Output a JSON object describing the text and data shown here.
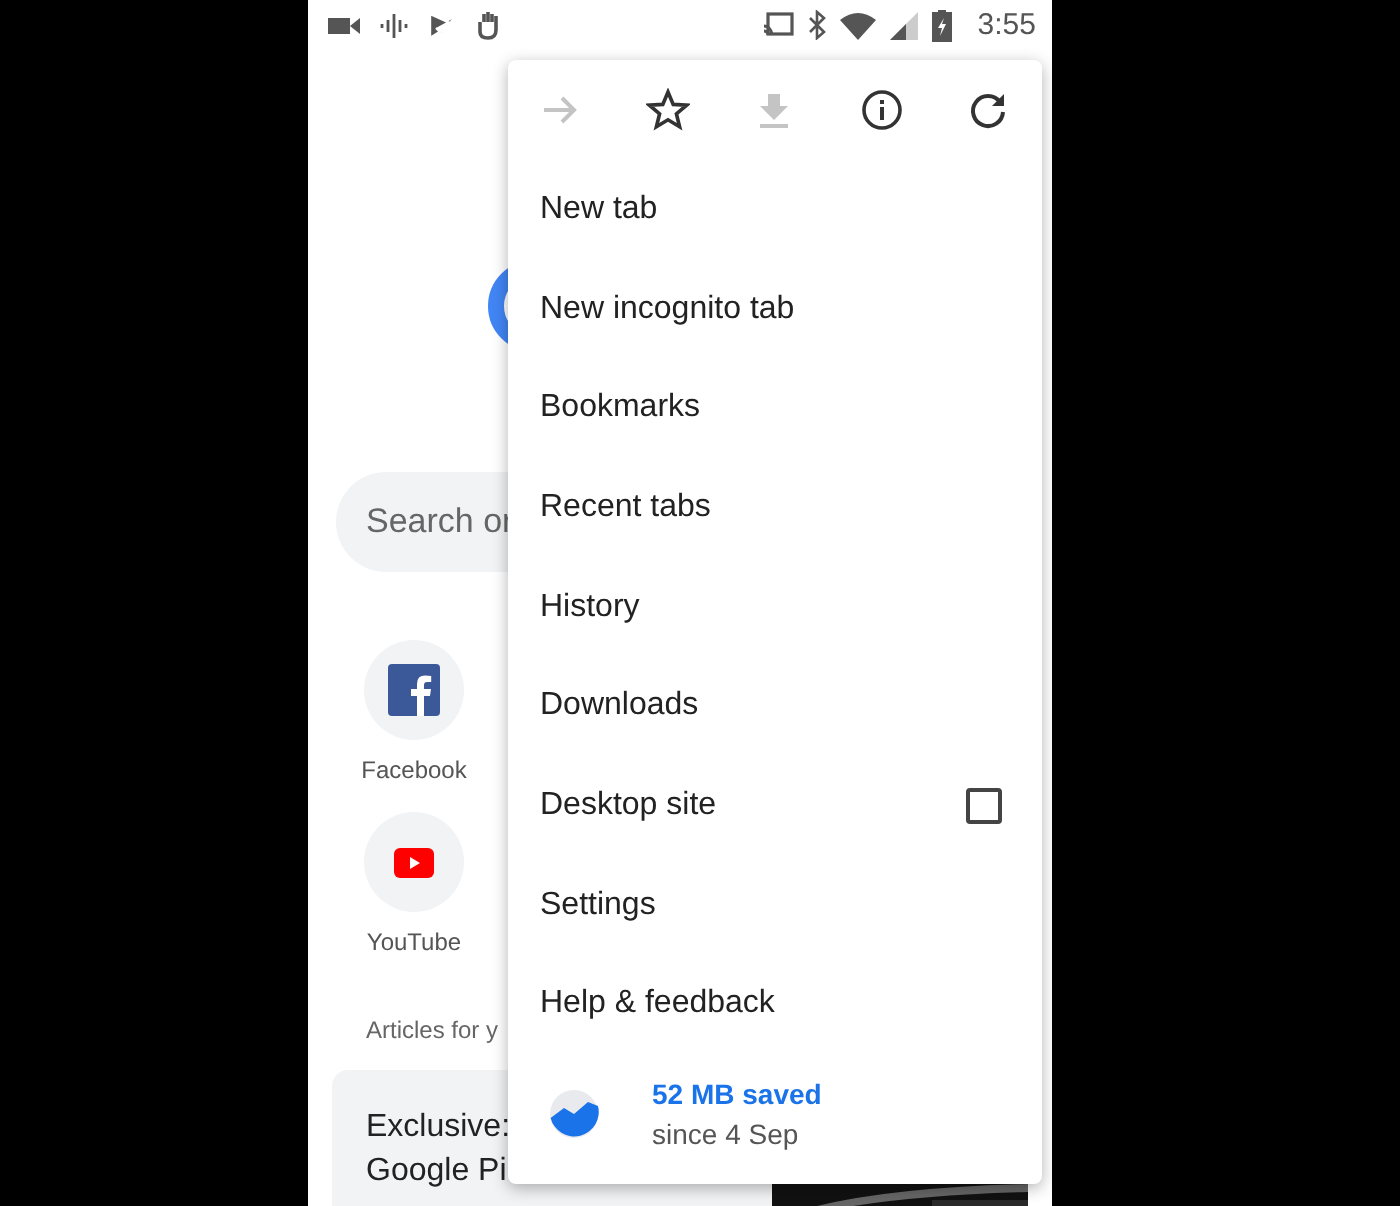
{
  "status_bar": {
    "time": "3:55"
  },
  "page": {
    "search": {
      "placeholder": "Search or"
    },
    "shortcuts": [
      {
        "label": "Facebook",
        "kind": "facebook"
      },
      {
        "label": "YouTube",
        "kind": "youtube"
      }
    ],
    "section_title": "Articles for y",
    "article": {
      "title_lines": [
        "Exclusive:",
        "Google Pi"
      ]
    }
  },
  "menu": {
    "toolbar": [
      {
        "kind": "forward",
        "disabled": true
      },
      {
        "kind": "bookmark",
        "disabled": false
      },
      {
        "kind": "download",
        "disabled": true
      },
      {
        "kind": "info",
        "disabled": false
      },
      {
        "kind": "reload",
        "disabled": false
      }
    ],
    "items": [
      {
        "label": "New tab",
        "kind": "plain"
      },
      {
        "label": "New incognito tab",
        "kind": "plain"
      },
      {
        "label": "Bookmarks",
        "kind": "plain"
      },
      {
        "label": "Recent tabs",
        "kind": "plain"
      },
      {
        "label": "History",
        "kind": "plain"
      },
      {
        "label": "Downloads",
        "kind": "plain"
      },
      {
        "label": "Desktop site",
        "kind": "checkbox",
        "checked": false
      },
      {
        "label": "Settings",
        "kind": "plain"
      },
      {
        "label": "Help & feedback",
        "kind": "plain"
      }
    ],
    "data_saver": {
      "amount": "52 MB saved",
      "since": "since 4 Sep"
    }
  }
}
